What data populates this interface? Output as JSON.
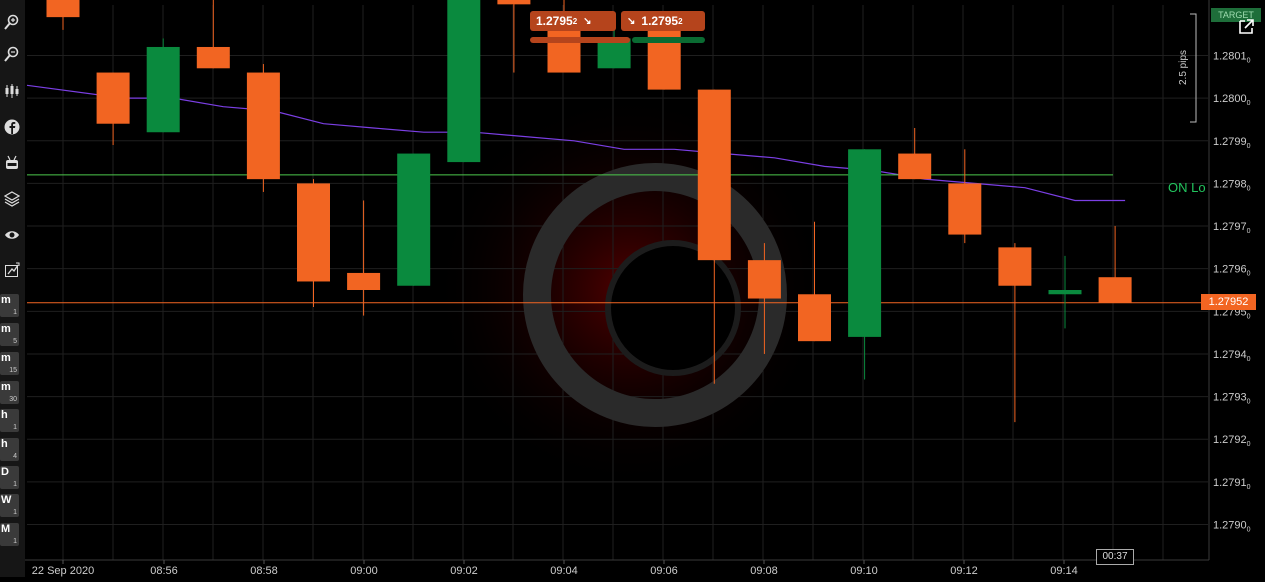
{
  "toolbar": {
    "tools": [
      {
        "name": "zoom-in-icon"
      },
      {
        "name": "zoom-out-icon"
      },
      {
        "name": "candles-icon"
      },
      {
        "name": "facebook-icon"
      },
      {
        "name": "robot-icon"
      },
      {
        "name": "layers-icon"
      },
      {
        "name": "eye-icon"
      },
      {
        "name": "draw-tool-icon"
      }
    ],
    "timeframes": [
      {
        "unit": "m",
        "num": "1"
      },
      {
        "unit": "m",
        "num": "5"
      },
      {
        "unit": "m",
        "num": "15"
      },
      {
        "unit": "m",
        "num": "30"
      },
      {
        "unit": "h",
        "num": "1"
      },
      {
        "unit": "h",
        "num": "4"
      },
      {
        "unit": "D",
        "num": "1"
      },
      {
        "unit": "W",
        "num": "1"
      },
      {
        "unit": "M",
        "num": "1"
      }
    ]
  },
  "trade": {
    "sell_price": "1.2795",
    "sell_sub": "2",
    "buy_price": "1.2795",
    "buy_sub": "2",
    "sell_arrow": "↘",
    "buy_arrow": "↘"
  },
  "target_label": "TARGET",
  "pips_label": "2.5 pips",
  "on_label": "ON Lo",
  "current_price": "1.27952",
  "countdown": "00:37",
  "colors": {
    "up": "#0a8a3e",
    "down": "#f26522",
    "ma": "#7b3fe4",
    "hline_green": "#4cc94c",
    "hline_orange": "#f26522"
  },
  "chart_data": {
    "type": "candlestick",
    "symbol_scale": "1.2790–1.2802",
    "ylim": [
      1.27895,
      1.28025
    ],
    "x_ticks": [
      "22 Sep 2020",
      "08:56",
      "08:58",
      "09:00",
      "09:02",
      "09:04",
      "09:06",
      "09:08",
      "09:10",
      "09:12",
      "09:14"
    ],
    "y_ticks": [
      {
        "v": 1.2801,
        "main": "1.2801",
        "sub": "0"
      },
      {
        "v": 1.28,
        "main": "1.2800",
        "sub": "0"
      },
      {
        "v": 1.2799,
        "main": "1.2799",
        "sub": "0"
      },
      {
        "v": 1.2798,
        "main": "1.2798",
        "sub": "0"
      },
      {
        "v": 1.2797,
        "main": "1.2797",
        "sub": "0"
      },
      {
        "v": 1.2796,
        "main": "1.2796",
        "sub": "0"
      },
      {
        "v": 1.2795,
        "main": "1.2795",
        "sub": "0"
      },
      {
        "v": 1.2794,
        "main": "1.2794",
        "sub": "0"
      },
      {
        "v": 1.2793,
        "main": "1.2793",
        "sub": "0"
      },
      {
        "v": 1.2792,
        "main": "1.2792",
        "sub": "0"
      },
      {
        "v": 1.2791,
        "main": "1.2791",
        "sub": "0"
      },
      {
        "v": 1.279,
        "main": "1.2790",
        "sub": "0"
      }
    ],
    "candles": [
      {
        "time": "08:55",
        "open": 1.28025,
        "high": 1.28025,
        "low": 1.28016,
        "close": 1.28019
      },
      {
        "time": "08:55:30",
        "open": 1.28006,
        "high": 1.28006,
        "low": 1.27989,
        "close": 1.27994
      },
      {
        "time": "08:56",
        "open": 1.27992,
        "high": 1.28014,
        "low": 1.27992,
        "close": 1.28012
      },
      {
        "time": "08:56:30",
        "open": 1.28012,
        "high": 1.28025,
        "low": 1.28007,
        "close": 1.28007
      },
      {
        "time": "08:57",
        "open": 1.28006,
        "high": 1.28008,
        "low": 1.27978,
        "close": 1.27981
      },
      {
        "time": "08:58",
        "open": 1.2798,
        "high": 1.27981,
        "low": 1.27951,
        "close": 1.27957
      },
      {
        "time": "08:59",
        "open": 1.27959,
        "high": 1.27976,
        "low": 1.27949,
        "close": 1.27955
      },
      {
        "time": "09:00",
        "open": 1.27956,
        "high": 1.27987,
        "low": 1.27956,
        "close": 1.27987
      },
      {
        "time": "09:01",
        "open": 1.27985,
        "high": 1.28025,
        "low": 1.27985,
        "close": 1.28025
      },
      {
        "time": "09:02",
        "open": 1.28025,
        "high": 1.28025,
        "low": 1.28006,
        "close": 1.28022
      },
      {
        "time": "09:03",
        "open": 1.28016,
        "high": 1.28025,
        "low": 1.28006,
        "close": 1.28006
      },
      {
        "time": "09:04",
        "open": 1.28007,
        "high": 1.2802,
        "low": 1.28007,
        "close": 1.28014
      },
      {
        "time": "09:05",
        "open": 1.28016,
        "high": 1.28016,
        "low": 1.28002,
        "close": 1.28002
      },
      {
        "time": "09:06",
        "open": 1.28002,
        "high": 1.28002,
        "low": 1.27933,
        "close": 1.27962
      },
      {
        "time": "09:07",
        "open": 1.27962,
        "high": 1.27966,
        "low": 1.2794,
        "close": 1.27953
      },
      {
        "time": "09:08",
        "open": 1.27954,
        "high": 1.27971,
        "low": 1.27943,
        "close": 1.27943
      },
      {
        "time": "09:09",
        "open": 1.27944,
        "high": 1.27988,
        "low": 1.27934,
        "close": 1.27988
      },
      {
        "time": "09:10",
        "open": 1.27987,
        "high": 1.27993,
        "low": 1.27981,
        "close": 1.27981
      },
      {
        "time": "09:11",
        "open": 1.2798,
        "high": 1.27988,
        "low": 1.27966,
        "close": 1.27968
      },
      {
        "time": "09:12",
        "open": 1.27965,
        "high": 1.27966,
        "low": 1.27924,
        "close": 1.27956
      },
      {
        "time": "09:13",
        "open": 1.27954,
        "high": 1.27963,
        "low": 1.27946,
        "close": 1.27955
      },
      {
        "time": "09:14",
        "open": 1.27958,
        "high": 1.2797,
        "low": 1.27952,
        "close": 1.27952
      }
    ],
    "moving_average": [
      1.28003,
      1.28,
      1.28,
      1.27998,
      1.27997,
      1.27994,
      1.27993,
      1.27992,
      1.27992,
      1.27991,
      1.2799,
      1.27988,
      1.27988,
      1.27987,
      1.27986,
      1.27984,
      1.27983,
      1.27981,
      1.2798,
      1.27979,
      1.27976,
      1.27976
    ],
    "horizontal_lines": [
      {
        "value": 1.27982,
        "color": "#4cc94c",
        "label": "ON Lo"
      },
      {
        "value": 1.27952,
        "color": "#f26522"
      }
    ]
  }
}
